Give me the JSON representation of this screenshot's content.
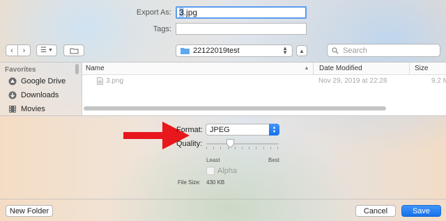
{
  "export": {
    "label": "Export As:",
    "value": "3.jpg",
    "selected_part": "3",
    "rest_part": ".jpg"
  },
  "tags": {
    "label": "Tags:",
    "value": ""
  },
  "toolbar": {
    "location": "22122019test",
    "search_placeholder": "Search"
  },
  "sidebar": {
    "section_title": "Favorites",
    "items": [
      {
        "label": "Google Drive",
        "icon": "google-drive-icon"
      },
      {
        "label": "Downloads",
        "icon": "downloads-icon"
      },
      {
        "label": "Movies",
        "icon": "movies-icon"
      }
    ]
  },
  "file_list": {
    "columns": {
      "name": "Name",
      "date": "Date Modified",
      "size": "Size"
    },
    "rows": [
      {
        "name": "3.png",
        "date": "Nov 29, 2019 at 22:28",
        "size": "9.2 M"
      }
    ]
  },
  "options": {
    "format_label": "Format:",
    "format_value": "JPEG",
    "quality_label": "Quality:",
    "quality_min_label": "Least",
    "quality_max_label": "Best",
    "quality_level": 0.33,
    "alpha_label": "Alpha",
    "alpha_checked": false,
    "filesize_label": "File Size:",
    "filesize_value": "430 KB"
  },
  "footer": {
    "new_folder": "New Folder",
    "cancel": "Cancel",
    "save": "Save"
  },
  "colors": {
    "accent": "#1671ea",
    "arrow": "#e8171b"
  }
}
